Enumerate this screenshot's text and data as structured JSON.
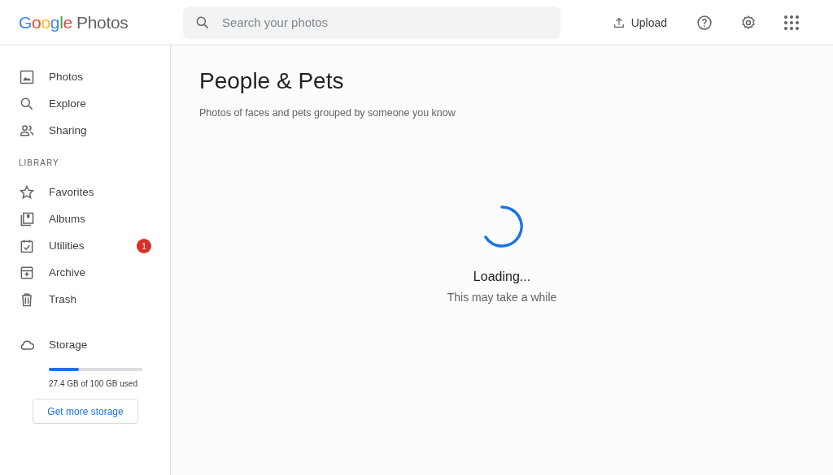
{
  "header": {
    "logo_brand": "Google",
    "logo_product": "Photos",
    "search": {
      "placeholder": "Search your photos"
    },
    "upload": "Upload"
  },
  "sidebar": {
    "items": [
      {
        "label": "Photos",
        "selected": false
      },
      {
        "label": "Explore",
        "selected": false
      },
      {
        "label": "Sharing",
        "selected": false
      }
    ],
    "library_heading": "LIBRARY",
    "library_items": [
      {
        "label": "Favorites",
        "selected": false
      },
      {
        "label": "Albums",
        "selected": false
      },
      {
        "label": "Utilities",
        "selected": false,
        "badge": "1"
      },
      {
        "label": "Archive",
        "selected": false
      },
      {
        "label": "Trash",
        "selected": false
      }
    ],
    "storage": {
      "label": "Storage",
      "level": 0.32,
      "usage": "27.4 GB of 100 GB used",
      "button": "Get more storage"
    }
  },
  "main": {
    "title": "People & Pets",
    "subtitle": "Photos of faces and pets grouped by someone you know",
    "loading": "Loading...",
    "note": "This may take a while"
  }
}
